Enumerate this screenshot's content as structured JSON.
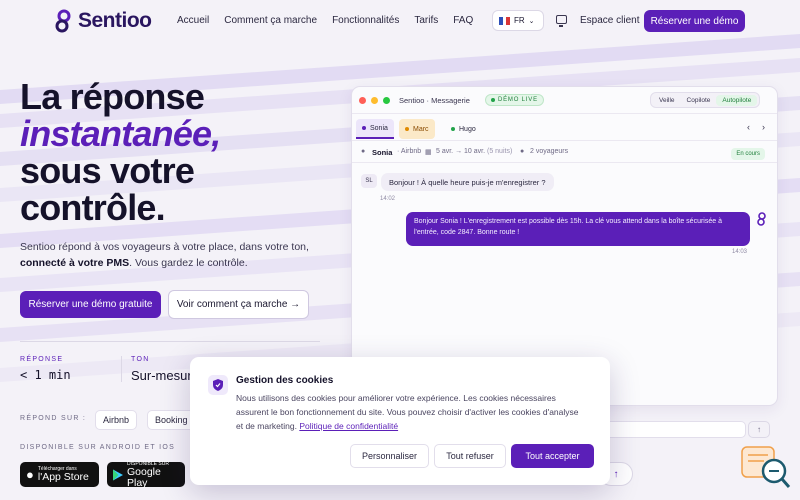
{
  "nav": {
    "brand": "Sentioo",
    "links": [
      "Accueil",
      "Comment ça marche",
      "Fonctionnalités",
      "Tarifs",
      "FAQ"
    ],
    "lang": "FR",
    "espace_client": "Espace client",
    "cta": "Réserver une démo"
  },
  "hero": {
    "title_line1": "La réponse",
    "title_accent": "instantanée,",
    "title_line3": "sous votre",
    "title_line4": "contrôle.",
    "sub_part1": "Sentioo répond à vos voyageurs à votre place, dans votre ton,",
    "sub_bold": "connecté à votre PMS",
    "sub_part2": ". Vous gardez le contrôle.",
    "cta_primary": "Réserver une démo gratuite",
    "cta_secondary": "Voir comment ça marche →"
  },
  "stats": [
    {
      "label": "RÉPONSE",
      "value": "< 1 min"
    },
    {
      "label": "TON",
      "value": "Sur-mesure"
    }
  ],
  "platforms": {
    "label": "RÉPOND SUR :",
    "items": [
      "Airbnb",
      "Booking"
    ]
  },
  "apps": {
    "label": "DISPONIBLE SUR ANDROID ET IOS",
    "appstore_small": "Télécharger dans",
    "appstore_big": "l'App Store",
    "googleplay_small": "DISPONIBLE SUR",
    "googleplay_big": "Google Play"
  },
  "mockup": {
    "window_title": "Sentioo · Messagerie",
    "live_badge": "DÉMO LIVE",
    "modes": [
      "Veille",
      "Copilote",
      "Autopilote"
    ],
    "tabs": [
      "Sonia",
      "Marc",
      "Hugo"
    ],
    "guest_name": "Sonia",
    "guest_source": "· Airbnb",
    "dates": "5 avr. → 10 avr.",
    "nights": "(5 nuits)",
    "guests": "2 voyageurs",
    "status": "En cours",
    "avatar": "SL",
    "msg_in": "Bonjour ! À quelle heure puis-je m'enregistrer ?",
    "time_in": "14:02",
    "msg_out": "Bonjour Sonia ! L'enregistrement est possible dès 15h. La clé vous attend dans la boîte sécurisée à l'entrée, code 2847. Bonne route !",
    "time_out": "14:03"
  },
  "cookie": {
    "title": "Gestion des cookies",
    "text": "Nous utilisons des cookies pour améliorer votre expérience. Les cookies nécessaires assurent le bon fonctionnement du site. Vous pouvez choisir d'activer les cookies d'analyse et de marketing.",
    "policy_link": "Politique de confidentialité",
    "btn_customize": "Personnaliser",
    "btn_refuse": "Tout refuser",
    "btn_accept": "Tout accepter"
  },
  "colors": {
    "brand": "#5b1fb8",
    "success": "#22803d",
    "background": "#f4f2f8"
  }
}
